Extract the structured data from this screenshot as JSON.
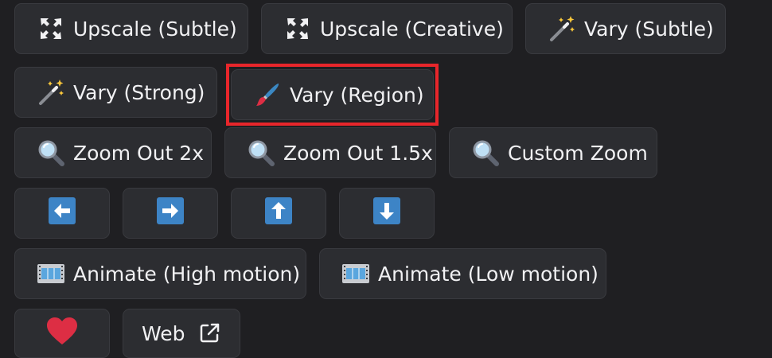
{
  "buttons": {
    "upscale_subtle": "Upscale (Subtle)",
    "upscale_creative": "Upscale (Creative)",
    "vary_subtle": "Vary (Subtle)",
    "vary_strong": "Vary (Strong)",
    "vary_region": "Vary (Region)",
    "zoom_out_2x": "Zoom Out 2x",
    "zoom_out_1_5x": "Zoom Out 1.5x",
    "custom_zoom": "Custom Zoom",
    "animate_high": "Animate (High motion)",
    "animate_low": "Animate (Low motion)",
    "web": "Web"
  },
  "icons": {
    "upscale": "expand-arrows-icon",
    "vary": "magic-wand-icon",
    "region": "paintbrush-icon",
    "zoom": "magnifier-icon",
    "pan": [
      "arrow-left-icon",
      "arrow-right-icon",
      "arrow-up-icon",
      "arrow-down-icon"
    ],
    "animate": "film-frames-icon",
    "favorite": "heart-icon",
    "external": "external-link-icon"
  },
  "colors": {
    "background": "#1f1f22",
    "button": "#2c2d31",
    "text": "#f1f1f3",
    "highlight": "#e8262b",
    "arrow_tile": "#3d84c6",
    "heart": "#dd2e44"
  }
}
